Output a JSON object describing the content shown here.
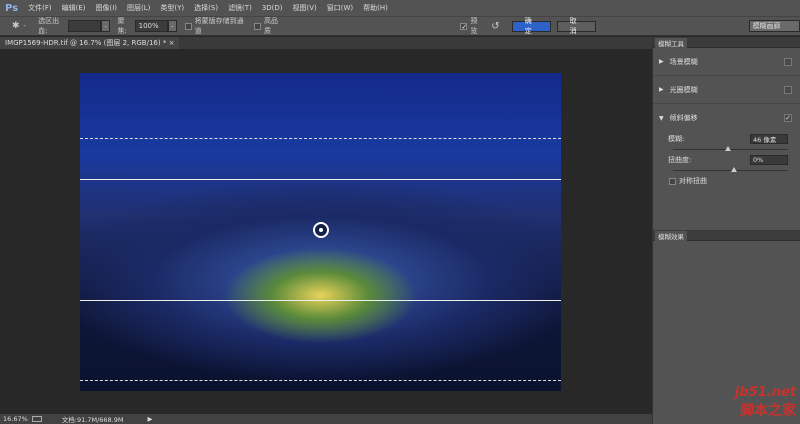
{
  "app": {
    "logo": "Ps"
  },
  "menu": [
    "文件(F)",
    "编辑(E)",
    "图像(I)",
    "图层(L)",
    "类型(Y)",
    "选择(S)",
    "滤镜(T)",
    "3D(D)",
    "视图(V)",
    "窗口(W)",
    "帮助(H)"
  ],
  "options": {
    "bleed_label": "选区出血:",
    "focus_label": "聚焦:",
    "focus_value": "100%",
    "save_mask": "将蒙版存储到通道",
    "high_quality": "高品质",
    "preview": "预览",
    "preview_checked": true,
    "ok": "确定",
    "cancel": "取消",
    "workspace": "模糊画廊"
  },
  "document": {
    "tab": "IMGP1569-HDR.tif @ 16.7% (图层 2, RGB/16) *",
    "close": "×"
  },
  "blur_tools": {
    "title": "模糊工具",
    "items": [
      {
        "label": "场景模糊",
        "checked": false
      },
      {
        "label": "光圈模糊",
        "checked": false
      },
      {
        "label": "倾斜偏移",
        "checked": true
      }
    ],
    "blur_label": "模糊:",
    "blur_value": "46 像素",
    "blur_slider": 0.45,
    "distortion_label": "扭曲度:",
    "distortion_value": "0%",
    "distortion_slider": 0.5,
    "symmetric": "对称扭曲"
  },
  "blur_effects": {
    "title": "模糊效果"
  },
  "status": {
    "zoom": "16.67%",
    "doc": "文档:91.7M/668.9M"
  },
  "watermark": {
    "line1": "jb51.net",
    "line2": "脚本之家"
  },
  "colors": {
    "ok_button": "#2d63c8"
  }
}
